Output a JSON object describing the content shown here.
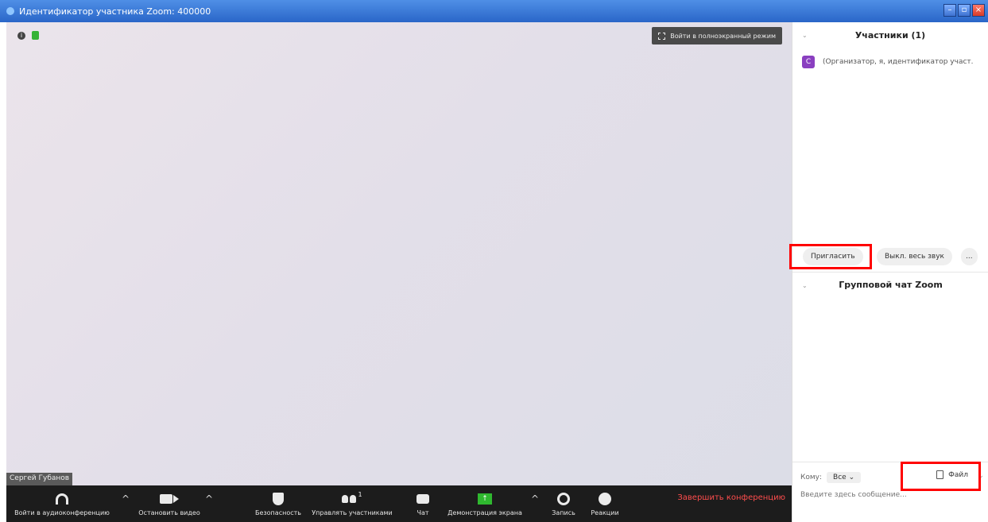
{
  "window": {
    "title": "Идентификатор участника Zoom: 400000",
    "minimize": "–",
    "maximize": "▫",
    "close": "×"
  },
  "video": {
    "fullscreen_label": "Войти в полноэкранный режим",
    "name_tag": "Сергей Губанов",
    "info_glyph": "i"
  },
  "toolbar": {
    "join_audio": "Войти в аудиоконференцию",
    "stop_video": "Остановить видео",
    "security": "Безопасность",
    "manage_participants": "Управлять участниками",
    "participants_count": "1",
    "chat": "Чат",
    "share_screen": "Демонстрация экрана",
    "share_glyph": "↑",
    "record": "Запись",
    "reactions": "Реакции",
    "end_meeting": "Завершить конференцию",
    "caret": "^"
  },
  "participants_panel": {
    "title": "Участники (1)",
    "collapse_glyph": "⌄",
    "participant": {
      "avatar_letter": "С",
      "name": "(Организатор, я, идентификатор участ..."
    },
    "invite": "Пригласить",
    "mute_all": "Выкл. весь звук",
    "more": "..."
  },
  "chat_panel": {
    "title": "Групповой чат Zoom",
    "collapse_glyph": "⌄",
    "to_label": "Кому:",
    "to_value": "Все ⌄",
    "file": "Файл",
    "input_placeholder": "Введите здесь сообщение...",
    "more_caret": "⌄"
  },
  "colors": {
    "accent_red": "#ff0000",
    "end_red": "#ff4d4d",
    "avatar": "#8a3fc0",
    "share_green": "#2fb82f"
  }
}
